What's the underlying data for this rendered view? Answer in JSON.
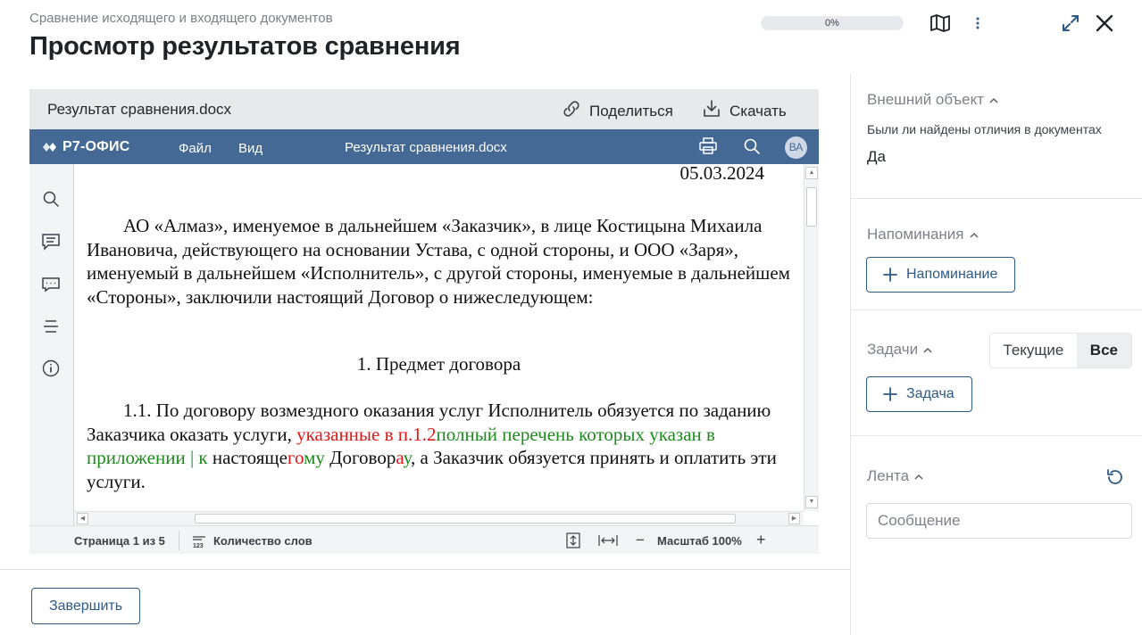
{
  "header": {
    "breadcrumb": "Сравнение исходящего и входящего документов",
    "title": "Просмотр результатов сравнения",
    "progress_text": "0%",
    "progress_value": 0,
    "icons": [
      "map-icon",
      "more-vertical-icon",
      "expand-icon",
      "close-icon"
    ]
  },
  "file_bar": {
    "file_name": "Результат сравнения.docx",
    "share_label": "Поделиться",
    "download_label": "Скачать"
  },
  "editor": {
    "brand": "Р7-ОФИС",
    "menu": [
      "Файл",
      "Вид"
    ],
    "doc_title": "Результат сравнения.docx",
    "avatar_initials": "ВА",
    "accent_color": "#446995",
    "left_tools": [
      "search-icon",
      "comment-icon",
      "chat-icon",
      "navigation-icon",
      "info-icon"
    ]
  },
  "document": {
    "date": "05.03.2024",
    "p1": "АО «Алмаз», именуемое в дальнейшем «Заказчик», в лице Костицына Михаила Ивановича, действующего на основании Устава, с одной стороны, и ООО «Заря», именуемый в дальнейшем «Исполнитель», с другой стороны, именуемые в дальнейшем «Стороны», заключили настоящий Договор о нижеследующем:",
    "section_heading": "1. Предмет договора",
    "p2": {
      "a": "1.1. По договору возмездного оказания услуг Исполнитель обязуется по заданию Заказчика оказать услуги, ",
      "deleted_1": "указанные в п.1.2",
      "inserted_1": "полный перечень которых указан в приложении | к",
      "b": " настояще",
      "deleted_2": "го",
      "inserted_2": "му",
      "c": " Договор",
      "deleted_3": "а",
      "inserted_3": "у",
      "d": ", а Заказчик обязуется принять и оплатить эти услуги."
    },
    "colors": {
      "inserted": "#1e8a1e",
      "deleted": "#e01818"
    }
  },
  "status_bar": {
    "page": "Страница 1 из 5",
    "word_count": "Количество слов",
    "zoom": "Масштаб 100%"
  },
  "footer": {
    "finish_label": "Завершить"
  },
  "side_panel": {
    "external_object": {
      "title": "Внешний объект",
      "field_label": "Были ли найдены отличия в документах",
      "field_value": "Да"
    },
    "reminders": {
      "title": "Напоминания",
      "add_label": "Напоминание"
    },
    "tasks": {
      "title": "Задачи",
      "filter_current": "Текущие",
      "filter_all": "Все",
      "add_label": "Задача"
    },
    "feed": {
      "title": "Лента",
      "message_placeholder": "Сообщение"
    }
  }
}
